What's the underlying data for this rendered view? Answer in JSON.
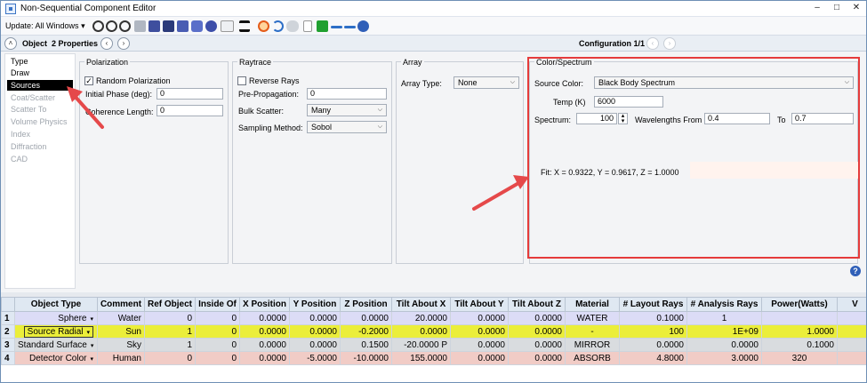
{
  "window": {
    "title": "Non-Sequential Component Editor",
    "minimize": "–",
    "maximize": "□",
    "close": "✕"
  },
  "toolbar": {
    "update_label": "Update: All Windows",
    "update_arrow": "▾"
  },
  "objbar": {
    "object_label": "Object",
    "properties_label": "2 Properties",
    "configuration_label": "Configuration 1/1"
  },
  "nav": {
    "type": "Type",
    "draw": "Draw",
    "sources": "Sources",
    "coat_scatter": "Coat/Scatter",
    "scatter_to": "Scatter To",
    "volume_physics": "Volume Physics",
    "index": "Index",
    "diffraction": "Diffraction",
    "cad": "CAD"
  },
  "polarization": {
    "title": "Polarization",
    "random_label": "Random Polarization",
    "random_checked": "✓",
    "initial_phase_label": "Initial Phase (deg):",
    "initial_phase_value": "0",
    "coherence_label": "Coherence Length:",
    "coherence_value": "0"
  },
  "raytrace": {
    "title": "Raytrace",
    "reverse_label": "Reverse Rays",
    "pre_prop_label": "Pre-Propagation:",
    "pre_prop_value": "0",
    "bulk_label": "Bulk Scatter:",
    "bulk_value": "Many",
    "sampling_label": "Sampling Method:",
    "sampling_value": "Sobol"
  },
  "array": {
    "title": "Array",
    "type_label": "Array Type:",
    "type_value": "None"
  },
  "color": {
    "title": "Color/Spectrum",
    "source_color_label": "Source Color:",
    "source_color_value": "Black Body Spectrum",
    "temp_label": "Temp (K)",
    "temp_value": "6000",
    "spectrum_label": "Spectrum:",
    "spectrum_value": "100",
    "wl_from_label": "Wavelengths From",
    "wl_from_value": "0.4",
    "to_label": "To",
    "wl_to_value": "0.7",
    "fit_text": "Fit: X = 0.9322, Y = 0.9617, Z = 1.0000"
  },
  "colors": {
    "highlight_border": "#e53b3b",
    "arrow": "#e5494a",
    "row_sphere": "#dcdcf6",
    "row_source": "#ebee3a",
    "row_standard": "#d9dcdf",
    "row_detector": "#f1ccc6"
  },
  "table": {
    "headers": [
      "",
      "Object Type",
      "Comment",
      "Ref Object",
      "Inside Of",
      "X Position",
      "Y Position",
      "Z Position",
      "Tilt About X",
      "Tilt About Y",
      "Tilt About Z",
      "Material",
      "# Layout Rays",
      "# Analysis Rays",
      "Power(Watts)",
      "V"
    ],
    "rows": [
      [
        "1",
        "Sphere",
        "Water",
        "0",
        "0",
        "0.0000",
        "0.0000",
        "0.0000",
        "20.0000",
        "0.0000",
        "0.0000",
        "WATER",
        "0.1000",
        "1",
        "",
        ""
      ],
      [
        "2",
        "Source Radial",
        "Sun",
        "1",
        "0",
        "0.0000",
        "0.0000",
        "-0.2000",
        "0.0000",
        "0.0000",
        "0.0000",
        "-",
        "100",
        "1E+09",
        "1.0000",
        ""
      ],
      [
        "3",
        "Standard Surface",
        "Sky",
        "1",
        "0",
        "0.0000",
        "0.0000",
        "0.1500",
        "-20.0000",
        "0.0000",
        "0.0000",
        "MIRROR",
        "0.0000",
        "0.0000",
        "0.1000",
        ""
      ],
      [
        "4",
        "Detector Color",
        "Human",
        "0",
        "0",
        "0.0000",
        "-5.0000",
        "-10.0000",
        "155.0000",
        "0.0000",
        "0.0000",
        "ABSORB",
        "4.8000",
        "3.0000",
        "320",
        ""
      ]
    ],
    "row3_tilt_solve": "P",
    "dropdown_glyph": "▾"
  },
  "help_glyph": "?"
}
